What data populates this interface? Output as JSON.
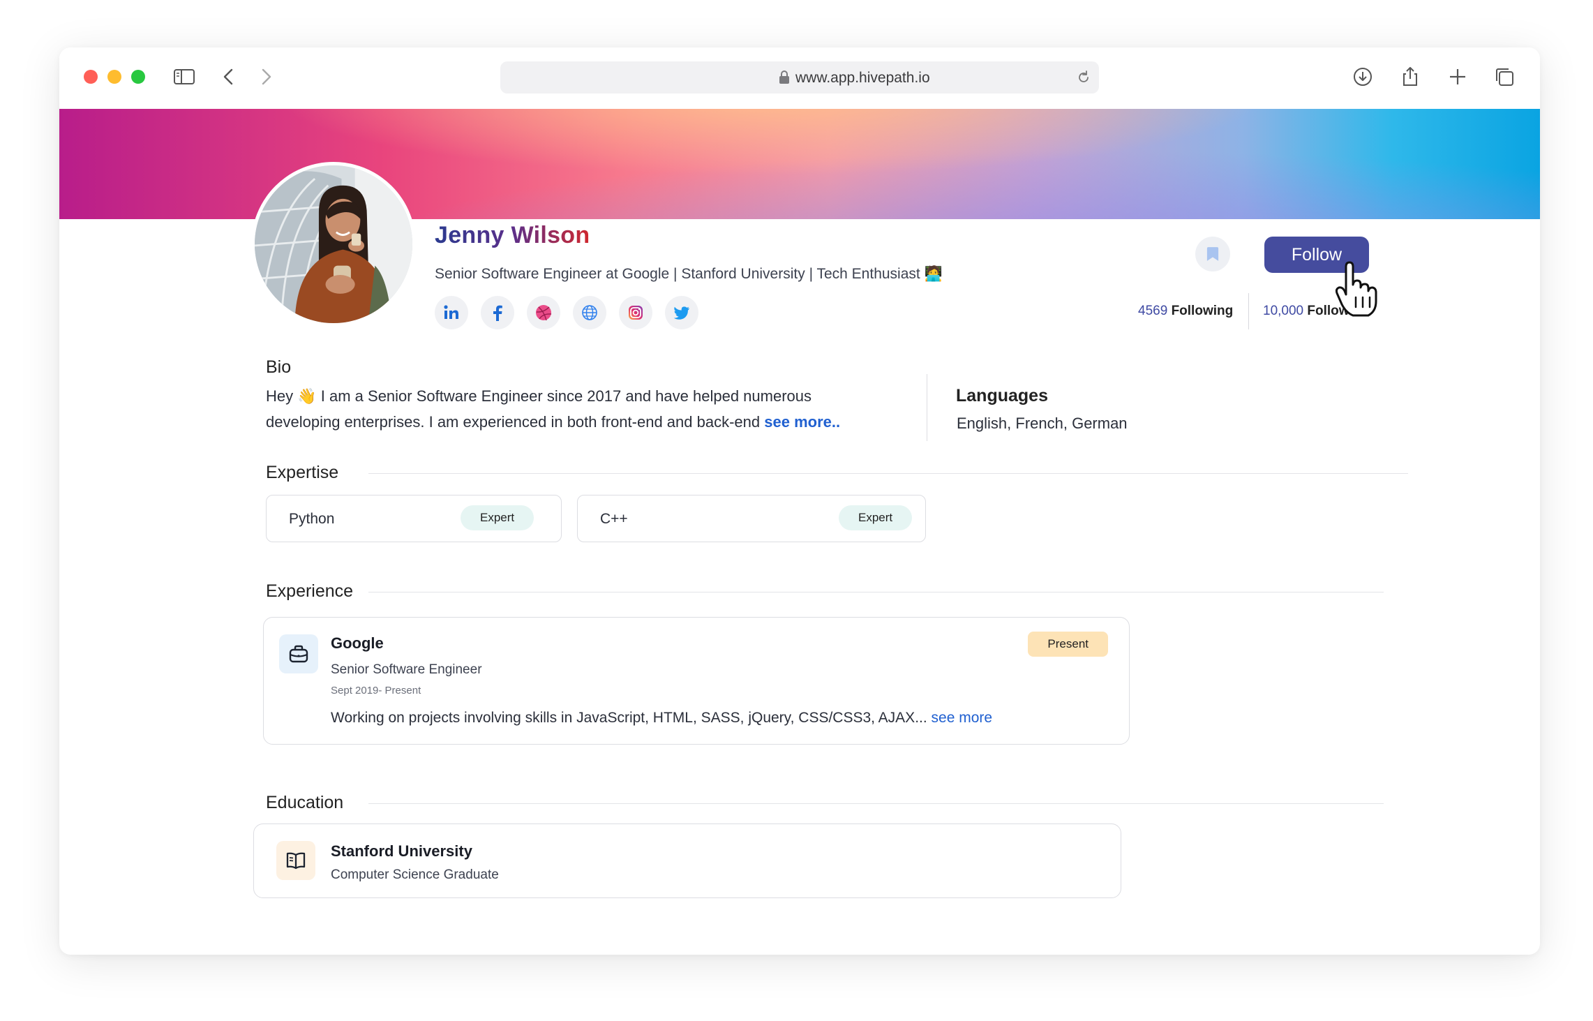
{
  "browser": {
    "url": "www.app.hivepath.io",
    "traffic_lights": {
      "close": "#ff5f57",
      "minimize": "#febc2e",
      "zoom": "#28c840"
    }
  },
  "profile": {
    "name": "Jenny Wilson",
    "headline": "Senior Software Engineer at Google | Stanford University | Tech Enthusiast",
    "headline_emoji": "🧑‍💻",
    "socials": [
      "linkedin-icon",
      "facebook-icon",
      "dribbble-icon",
      "globe-icon",
      "instagram-icon",
      "twitter-icon"
    ],
    "follow_label": "Follow",
    "following_count": "4569",
    "following_label": "Following",
    "followers_count": "10,000",
    "followers_label": "Followers"
  },
  "bio": {
    "title": "Bio",
    "text_start": "Hey",
    "wave": "👋",
    "text": "I am a Senior Software Engineer since 2017 and have helped numerous developing enterprises. I am experienced in both front-end and back-end",
    "see_more": "see more.."
  },
  "languages": {
    "title": "Languages",
    "value": "English, French, German"
  },
  "expertise": {
    "title": "Expertise",
    "items": [
      {
        "skill": "Python",
        "level": "Expert"
      },
      {
        "skill": "C++",
        "level": "Expert"
      }
    ]
  },
  "experience": {
    "title": "Experience",
    "items": [
      {
        "company": "Google",
        "role": "Senior Software Engineer",
        "dates": "Sept 2019- Present",
        "description": "Working on projects involving skills in JavaScript, HTML, SASS, jQuery, CSS/CSS3, AJAX...",
        "see_more": "see more",
        "badge": "Present"
      }
    ]
  },
  "education": {
    "title": "Education",
    "items": [
      {
        "school": "Stanford University",
        "degree": "Computer Science Graduate"
      }
    ]
  },
  "colors": {
    "accent": "#454c9e",
    "link": "#2060d0",
    "expert_badge": "#e6f5f3",
    "present_badge": "#fde3b6"
  }
}
